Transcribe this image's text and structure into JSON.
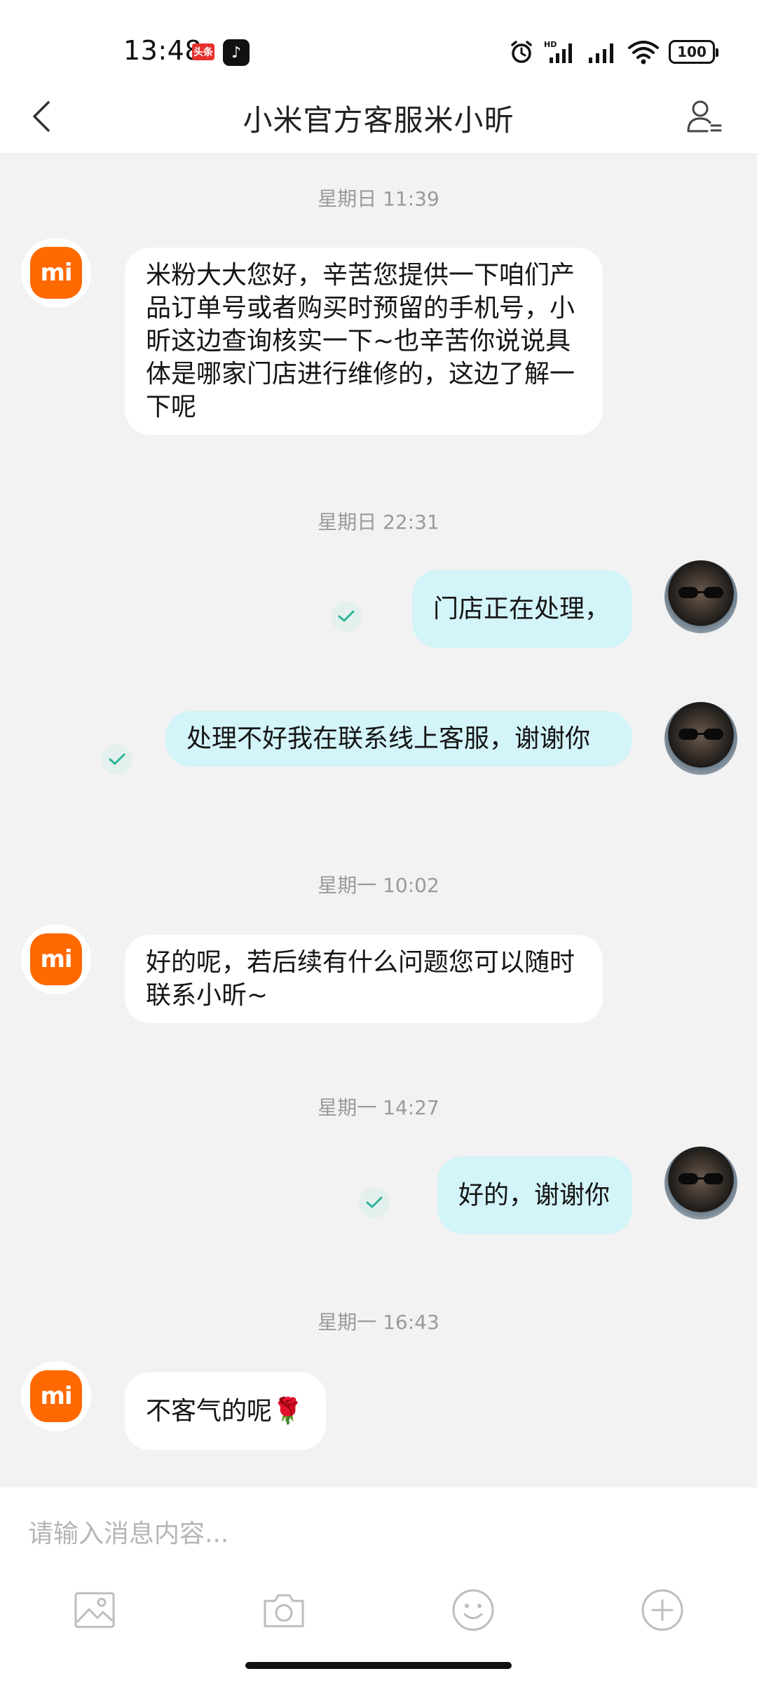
{
  "status_bar": {
    "time": "13:48",
    "toutiao_label": "头条",
    "battery": "100"
  },
  "header": {
    "title": "小米官方客服米小昕"
  },
  "messages": [
    {
      "type": "timestamp",
      "text": "星期日 11:39"
    },
    {
      "type": "incoming",
      "text": "米粉大大您好，辛苦您提供一下咱们产品订单号或者购买时预留的手机号，小昕这边查询核实一下~也辛苦你说说具体是哪家门店进行维修的，这边了解一下呢"
    },
    {
      "type": "timestamp",
      "text": "星期日 22:31"
    },
    {
      "type": "outgoing",
      "text": "门店正在处理，"
    },
    {
      "type": "outgoing",
      "text": "处理不好我在联系线上客服，谢谢你"
    },
    {
      "type": "timestamp",
      "text": "星期一 10:02"
    },
    {
      "type": "incoming",
      "text": "好的呢，若后续有什么问题您可以随时联系小昕~"
    },
    {
      "type": "timestamp",
      "text": "星期一 14:27"
    },
    {
      "type": "outgoing",
      "text": "好的，谢谢你"
    },
    {
      "type": "timestamp",
      "text": "星期一 16:43"
    },
    {
      "type": "incoming",
      "text": "不客气的呢🌹"
    }
  ],
  "agent_avatar_logo": "mi",
  "input": {
    "placeholder": "请输入消息内容..."
  },
  "toolbar_icons": [
    "image-icon",
    "camera-icon",
    "emoji-icon",
    "plus-icon"
  ],
  "colors": {
    "brand_orange": "#ff6900",
    "outgoing_bubble": "#d3f4f8",
    "incoming_bubble": "#ffffff",
    "chat_background": "#f2f2f2",
    "read_check": "#2bb59a"
  }
}
